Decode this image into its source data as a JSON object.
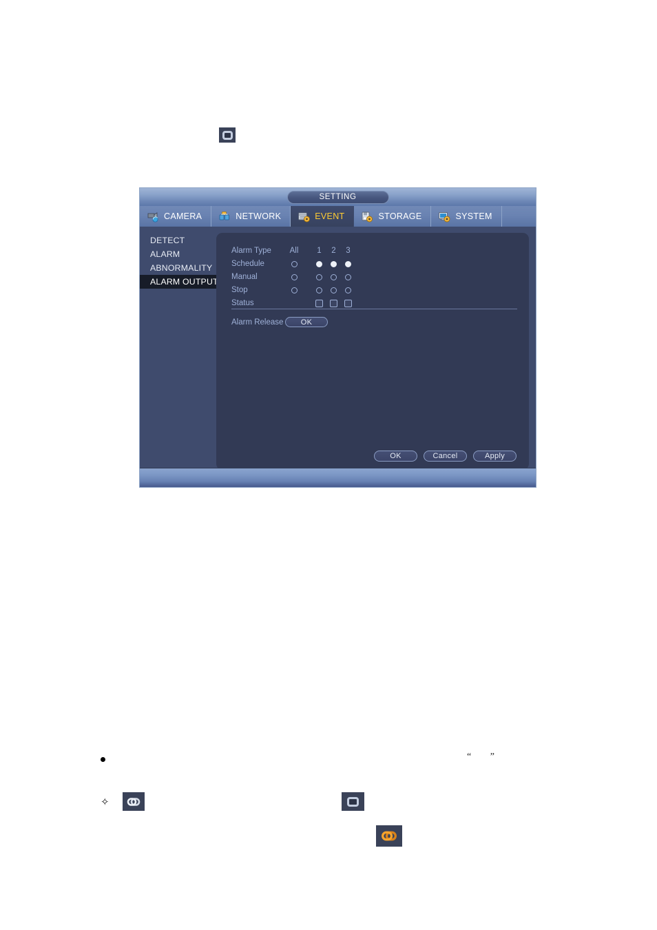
{
  "dialog": {
    "title": "SETTING",
    "tabs": [
      {
        "label": "CAMERA",
        "icon": "camera-icon",
        "active": false
      },
      {
        "label": "NETWORK",
        "icon": "network-icon",
        "active": false
      },
      {
        "label": "EVENT",
        "icon": "event-icon",
        "active": true
      },
      {
        "label": "STORAGE",
        "icon": "storage-icon",
        "active": false
      },
      {
        "label": "SYSTEM",
        "icon": "system-icon",
        "active": false
      }
    ],
    "sidebar": {
      "items": [
        {
          "label": "DETECT",
          "active": false
        },
        {
          "label": "ALARM",
          "active": false
        },
        {
          "label": "ABNORMALITY",
          "active": false
        },
        {
          "label": "ALARM OUTPUT",
          "active": true
        }
      ]
    },
    "form": {
      "header": {
        "label": "Alarm Type",
        "all": "All",
        "channels": [
          "1",
          "2",
          "3"
        ]
      },
      "rows": [
        {
          "label": "Schedule",
          "all": false,
          "channels": [
            true,
            true,
            true
          ]
        },
        {
          "label": "Manual",
          "all": false,
          "channels": [
            false,
            false,
            false
          ]
        },
        {
          "label": "Stop",
          "all": false,
          "channels": [
            false,
            false,
            false
          ]
        }
      ],
      "status": {
        "label": "Status",
        "channels": [
          false,
          false,
          false
        ]
      },
      "alarm_release": {
        "label": "Alarm Release",
        "button": "OK"
      }
    },
    "footer_buttons": [
      {
        "label": "OK"
      },
      {
        "label": "Cancel"
      },
      {
        "label": "Apply"
      }
    ]
  },
  "annotations": {
    "quote_marks": "“  ”",
    "diamond_bullet": "✧",
    "icons": {
      "top_rounded_square": "rounded-square-icon",
      "chain_gray": "chain-link-icon",
      "rounded_square": "rounded-square-icon",
      "chain_orange": "chain-link-active-icon"
    }
  },
  "colors": {
    "accent_active_tab_text": "#ffcc33",
    "dialog_bg": "#3f4b6d",
    "panel_bg": "#323a55",
    "titlebar_light": "#9fb4d6",
    "label_blue": "#9fb1d8",
    "chain_orange": "#f0921e"
  }
}
